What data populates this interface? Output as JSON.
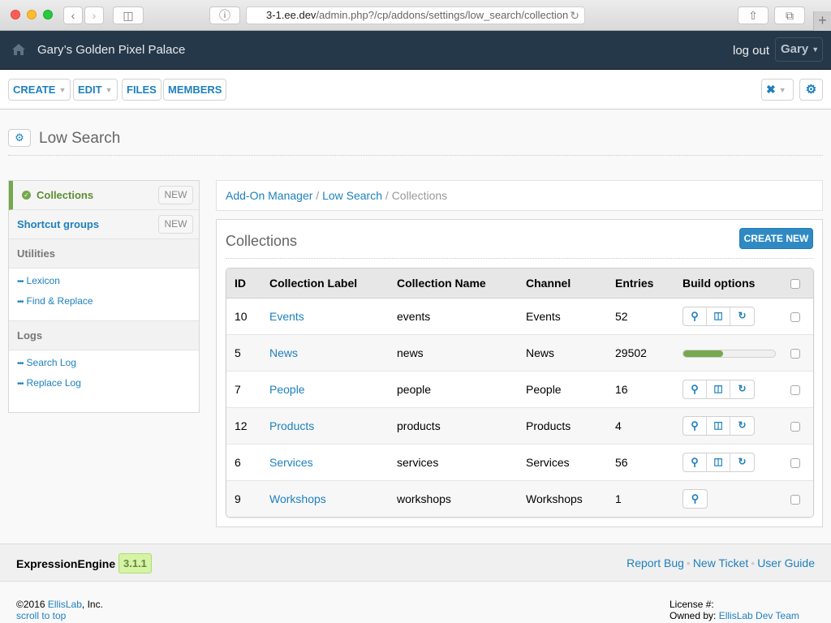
{
  "browser": {
    "url_host": "3-1.ee.dev",
    "url_path": "/admin.php?/cp/addons/settings/low_search/collection",
    "new_tab_glyph": "+"
  },
  "topnav": {
    "site_name": "Gary’s Golden Pixel Palace",
    "logout_label": "log out",
    "user_label": "Gary"
  },
  "toolbar": {
    "create_label": "CREATE",
    "edit_label": "EDIT",
    "files_label": "FILES",
    "members_label": "MEMBERS"
  },
  "page": {
    "title": "Low Search"
  },
  "sidebar": {
    "items": [
      {
        "label": "Collections",
        "badge": "NEW",
        "active": true
      },
      {
        "label": "Shortcut groups",
        "badge": "NEW",
        "active": false
      }
    ],
    "sections": [
      {
        "heading": "Utilities",
        "links": [
          "Lexicon",
          "Find & Replace"
        ]
      },
      {
        "heading": "Logs",
        "links": [
          "Search Log",
          "Replace Log"
        ]
      }
    ]
  },
  "breadcrumb": {
    "items": [
      "Add-On Manager",
      "Low Search"
    ],
    "separator": "/",
    "current": "Collections"
  },
  "collections": {
    "title": "Collections",
    "create_new_label": "CREATE NEW",
    "columns": [
      "ID",
      "Collection Label",
      "Collection Name",
      "Channel",
      "Entries",
      "Build options"
    ],
    "rows": [
      {
        "id": "10",
        "label": "Events",
        "name": "events",
        "channel": "Events",
        "entries": "52",
        "build": [
          "search",
          "index",
          "refresh"
        ],
        "progress": null
      },
      {
        "id": "5",
        "label": "News",
        "name": "news",
        "channel": "News",
        "entries": "29502",
        "build": [],
        "progress": 0.43
      },
      {
        "id": "7",
        "label": "People",
        "name": "people",
        "channel": "People",
        "entries": "16",
        "build": [
          "search",
          "index",
          "refresh"
        ],
        "progress": null
      },
      {
        "id": "12",
        "label": "Products",
        "name": "products",
        "channel": "Products",
        "entries": "4",
        "build": [
          "search",
          "index",
          "refresh"
        ],
        "progress": null
      },
      {
        "id": "6",
        "label": "Services",
        "name": "services",
        "channel": "Services",
        "entries": "56",
        "build": [
          "search",
          "index",
          "refresh"
        ],
        "progress": null
      },
      {
        "id": "9",
        "label": "Workshops",
        "name": "workshops",
        "channel": "Workshops",
        "entries": "1",
        "build": [
          "search"
        ],
        "progress": null
      }
    ]
  },
  "footer": {
    "product": "ExpressionEngine",
    "version": "3.1.1",
    "links": [
      "Report Bug",
      "New Ticket",
      "User Guide"
    ],
    "copyright_prefix": "©2016 ",
    "company_link": "EllisLab",
    "copyright_suffix": ", Inc.",
    "scroll_top": "scroll to top",
    "license_label": "License #:",
    "owned_by_label": "Owned by: ",
    "owner_link": "EllisLab Dev Team"
  },
  "colors": {
    "nav_bg": "#25384a",
    "link": "#1f80bd",
    "active_green": "#74a84d",
    "primary_button": "#2f8ac4"
  }
}
